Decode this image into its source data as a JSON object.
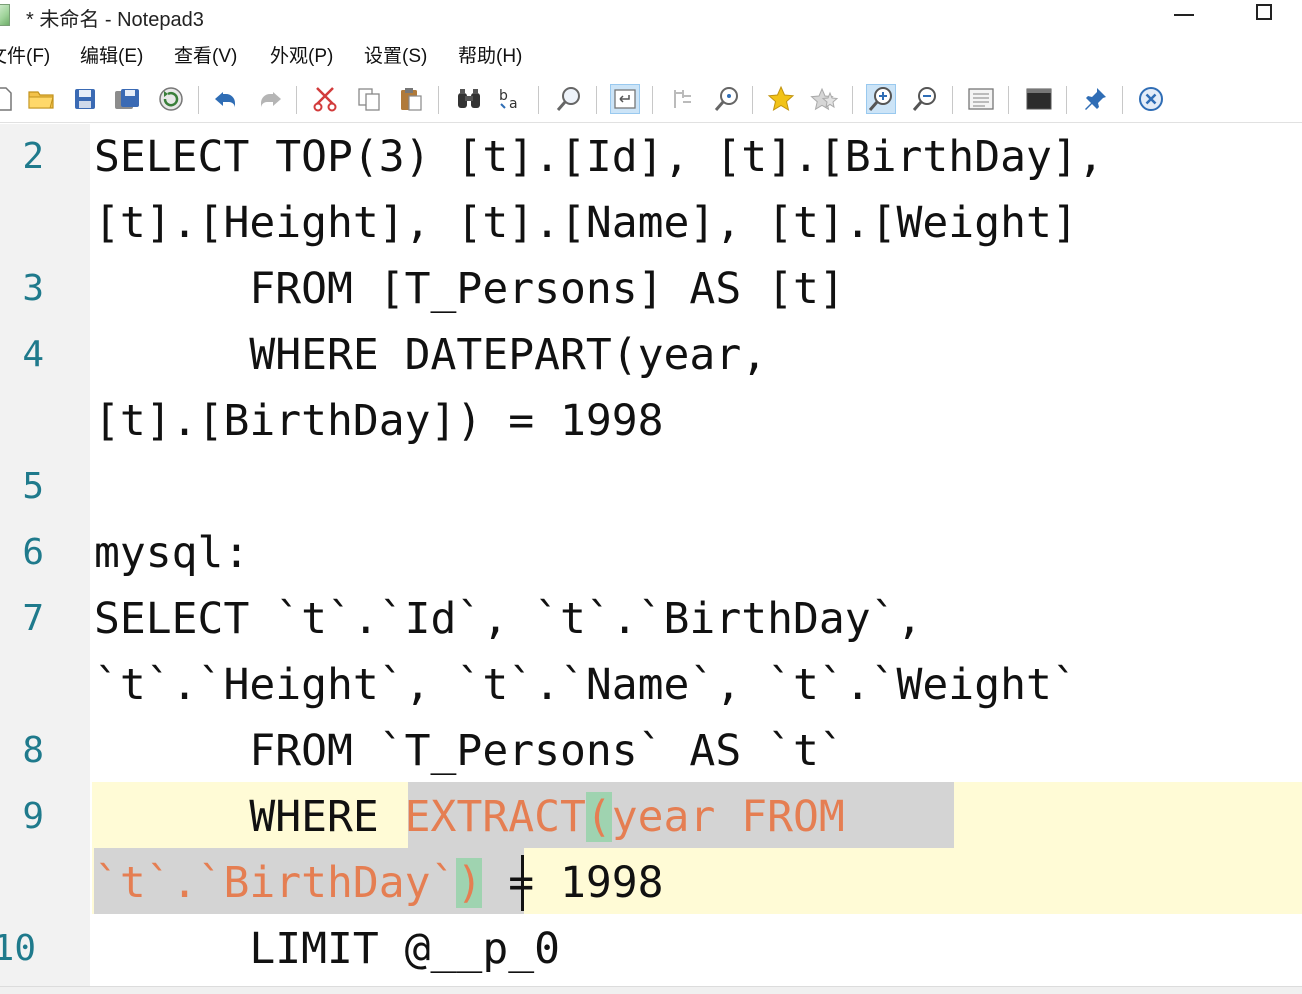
{
  "window": {
    "title": "* 未命名 - Notepad3",
    "minimize_label": "",
    "maximize_label": ""
  },
  "menu": {
    "items": [
      {
        "label": "文件(F)"
      },
      {
        "label": "编辑(E)"
      },
      {
        "label": "查看(V)"
      },
      {
        "label": "外观(P)"
      },
      {
        "label": "设置(S)"
      },
      {
        "label": "帮助(H)"
      }
    ]
  },
  "toolbar": {
    "buttons": [
      {
        "icon": "new-file-icon"
      },
      {
        "icon": "open-folder-icon"
      },
      {
        "icon": "save-icon"
      },
      {
        "icon": "save-as-icon"
      },
      {
        "icon": "revert-icon"
      },
      {
        "icon": "undo-icon"
      },
      {
        "icon": "redo-icon"
      },
      {
        "icon": "cut-icon"
      },
      {
        "icon": "copy-icon"
      },
      {
        "icon": "paste-icon"
      },
      {
        "icon": "find-icon"
      },
      {
        "icon": "replace-icon"
      },
      {
        "icon": "find-next-icon"
      },
      {
        "icon": "word-wrap-icon"
      },
      {
        "icon": "indent-guides-icon"
      },
      {
        "icon": "goto-icon"
      },
      {
        "icon": "add-favorite-icon"
      },
      {
        "icon": "favorites-icon"
      },
      {
        "icon": "zoom-in-icon"
      },
      {
        "icon": "zoom-out-icon"
      },
      {
        "icon": "schemes-icon"
      },
      {
        "icon": "terminal-icon"
      },
      {
        "icon": "pin-icon"
      },
      {
        "icon": "exit-icon"
      }
    ],
    "colors": {
      "pressed_bg": "#cce4f7",
      "pressed_border": "#99c9ef"
    }
  },
  "editor": {
    "line_numbers": [
      "2",
      "3",
      "4",
      "5",
      "6",
      "7",
      "8",
      "9",
      "10"
    ],
    "lines": {
      "l2a": "SELECT TOP(3) [t].[Id], [t].[BirthDay],",
      "l2b": "[t].[Height], [t].[Name], [t].[Weight]",
      "l3": "      FROM [T_Persons] AS [t]",
      "l4a": "      WHERE DATEPART(year,",
      "l4b": "[t].[BirthDay]) = 1998",
      "l5": "",
      "l6": "mysql:",
      "l7a": "SELECT `t`.`Id`, `t`.`BirthDay`,",
      "l7b": "`t`.`Height`, `t`.`Name`, `t`.`Weight`",
      "l8": "      FROM `T_Persons` AS `t`",
      "l9a_prefix": "      WHERE ",
      "l9a_fn": "EXTRACT",
      "l9a_paren": "(",
      "l9a_rest": "year FROM ",
      "l9b_sel": "`t`.`BirthDay`",
      "l9b_paren": ")",
      "l9b_rest": " = 1998",
      "l10": "      LIMIT @__p_0"
    },
    "colors": {
      "line_number": "#1f7a8c",
      "current_line": "#fffbd6",
      "selection": "#d4d4d4",
      "highlight_text": "#e57e52",
      "brace_match": "#9fd3b0"
    }
  }
}
